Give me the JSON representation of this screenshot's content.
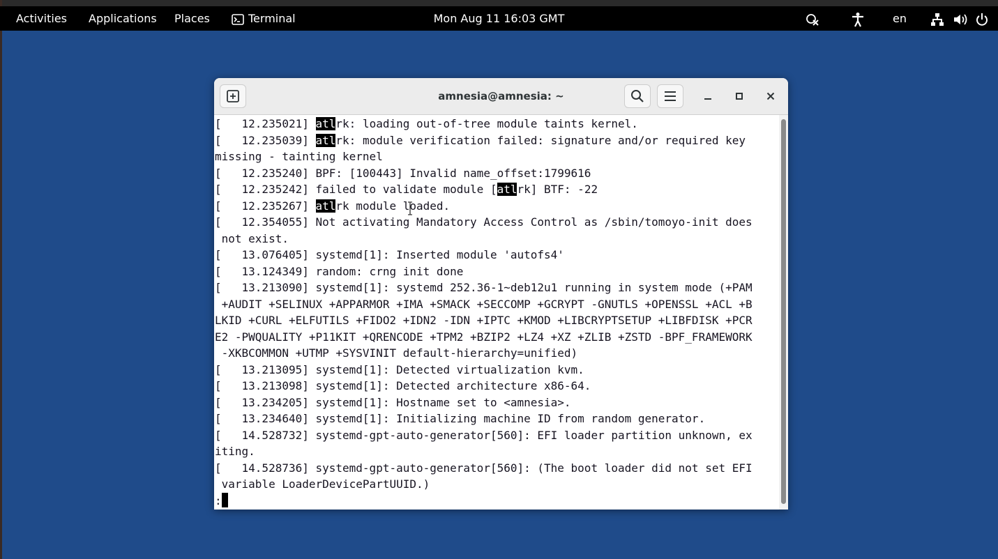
{
  "topbar": {
    "activities": "Activities",
    "applications": "Applications",
    "places": "Places",
    "terminal": "Terminal",
    "clock": "Mon Aug 11  16:03 GMT",
    "language": "en"
  },
  "window": {
    "title": "amnesia@amnesia: ~"
  },
  "terminal": {
    "lines": [
      [
        {
          "t": "[   12.235021] "
        },
        {
          "t": "atl",
          "hl": true
        },
        {
          "t": "rk: loading out-of-tree module taints kernel."
        }
      ],
      [
        {
          "t": "[   12.235039] "
        },
        {
          "t": "atl",
          "hl": true
        },
        {
          "t": "rk: module verification failed: signature and/or required key"
        }
      ],
      [
        {
          "t": "missing - tainting kernel"
        }
      ],
      [
        {
          "t": "[   12.235240] BPF: [100443] Invalid name_offset:1799616"
        }
      ],
      [
        {
          "t": "[   12.235242] failed to validate module ["
        },
        {
          "t": "atl",
          "hl": true
        },
        {
          "t": "rk] BTF: -22"
        }
      ],
      [
        {
          "t": "[   12.235267] "
        },
        {
          "t": "atl",
          "hl": true
        },
        {
          "t": "rk module loaded."
        }
      ],
      [
        {
          "t": "[   12.354055] Not activating Mandatory Access Control as /sbin/tomoyo-init does"
        }
      ],
      [
        {
          "t": " not exist."
        }
      ],
      [
        {
          "t": "[   13.076405] systemd[1]: Inserted module 'autofs4'"
        }
      ],
      [
        {
          "t": "[   13.124349] random: crng init done"
        }
      ],
      [
        {
          "t": "[   13.213090] systemd[1]: systemd 252.36-1~deb12u1 running in system mode (+PAM"
        }
      ],
      [
        {
          "t": " +AUDIT +SELINUX +APPARMOR +IMA +SMACK +SECCOMP +GCRYPT -GNUTLS +OPENSSL +ACL +B"
        }
      ],
      [
        {
          "t": "LKID +CURL +ELFUTILS +FIDO2 +IDN2 -IDN +IPTC +KMOD +LIBCRYPTSETUP +LIBFDISK +PCR"
        }
      ],
      [
        {
          "t": "E2 -PWQUALITY +P11KIT +QRENCODE +TPM2 +BZIP2 +LZ4 +XZ +ZLIB +ZSTD -BPF_FRAMEWORK"
        }
      ],
      [
        {
          "t": " -XKBCOMMON +UTMP +SYSVINIT default-hierarchy=unified)"
        }
      ],
      [
        {
          "t": "[   13.213095] systemd[1]: Detected virtualization kvm."
        }
      ],
      [
        {
          "t": "[   13.213098] systemd[1]: Detected architecture x86-64."
        }
      ],
      [
        {
          "t": "[   13.234205] systemd[1]: Hostname set to <amnesia>."
        }
      ],
      [
        {
          "t": "[   13.234640] systemd[1]: Initializing machine ID from random generator."
        }
      ],
      [
        {
          "t": "[   14.528732] systemd-gpt-auto-generator[560]: EFI loader partition unknown, ex"
        }
      ],
      [
        {
          "t": "iting."
        }
      ],
      [
        {
          "t": "[   14.528736] systemd-gpt-auto-generator[560]: (The boot loader did not set EFI"
        }
      ],
      [
        {
          "t": " variable LoaderDevicePartUUID.)"
        }
      ]
    ],
    "prompt": ":"
  },
  "icons": {
    "terminal_app": "terminal-icon",
    "new_tab": "new-tab-icon",
    "search": "search-icon",
    "menu": "hamburger-menu-icon",
    "minimize": "minimize-icon",
    "maximize": "maximize-icon",
    "close": "close-icon",
    "system_tray": [
      "disabled-pointer-icon",
      "accessibility-icon",
      "network-icon",
      "volume-icon",
      "power-icon"
    ]
  },
  "colors": {
    "desktop": "#1f4b8a",
    "topbar": "#000000",
    "titlebar": "#ececec",
    "terminal_bg": "#ffffff",
    "terminal_fg": "#171421",
    "highlight_bg": "#000000"
  }
}
